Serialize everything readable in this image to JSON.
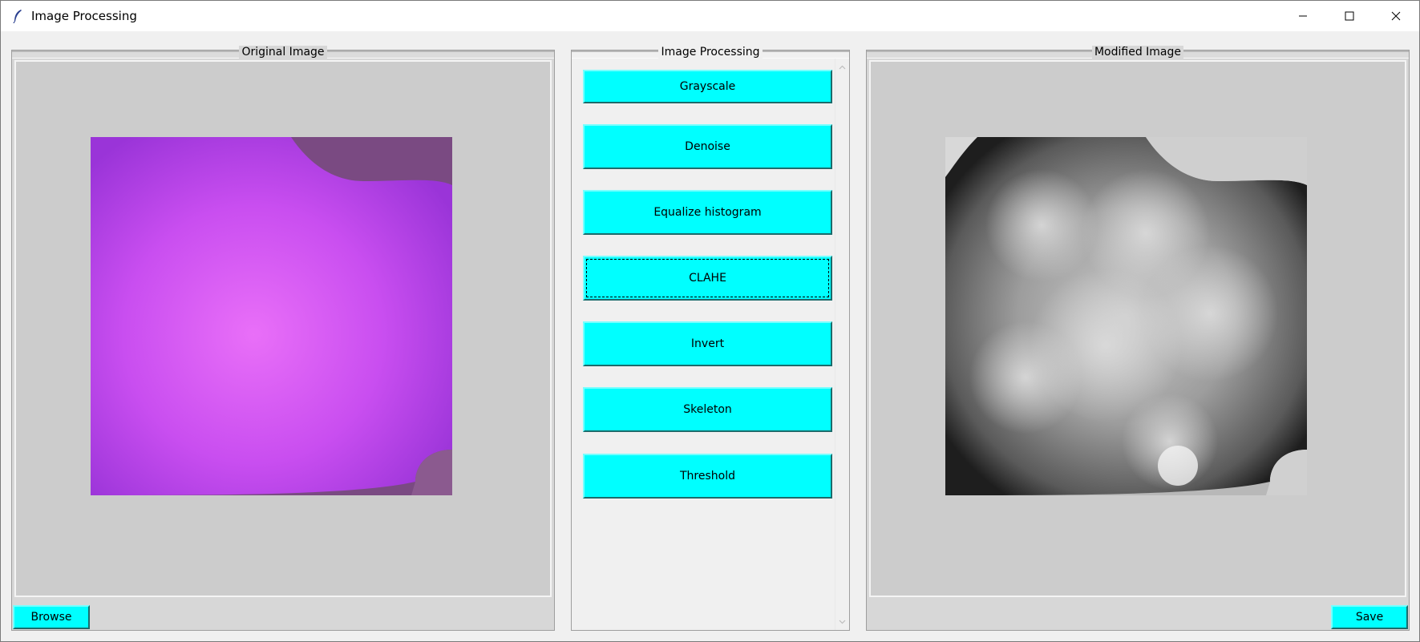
{
  "window": {
    "title": "Image Processing",
    "controls": {
      "minimize": "minimize",
      "maximize": "maximize",
      "close": "close"
    }
  },
  "left_panel": {
    "title": "Original Image",
    "browse_label": "Browse"
  },
  "middle_panel": {
    "title": "Image Processing",
    "buttons": [
      {
        "label": "Grayscale"
      },
      {
        "label": "Denoise"
      },
      {
        "label": "Equalize histogram"
      },
      {
        "label": "CLAHE"
      },
      {
        "label": "Invert"
      },
      {
        "label": "Skeleton"
      },
      {
        "label": "Threshold"
      }
    ]
  },
  "right_panel": {
    "title": "Modified Image",
    "save_label": "Save"
  },
  "colors": {
    "button_bg": "#00ffff",
    "original_image": "#c44ef0",
    "canvas_bg": "#cccccc"
  },
  "icons": {
    "app": "feather-icon",
    "scroll_up": "chevron-up-icon",
    "scroll_down": "chevron-down-icon"
  }
}
